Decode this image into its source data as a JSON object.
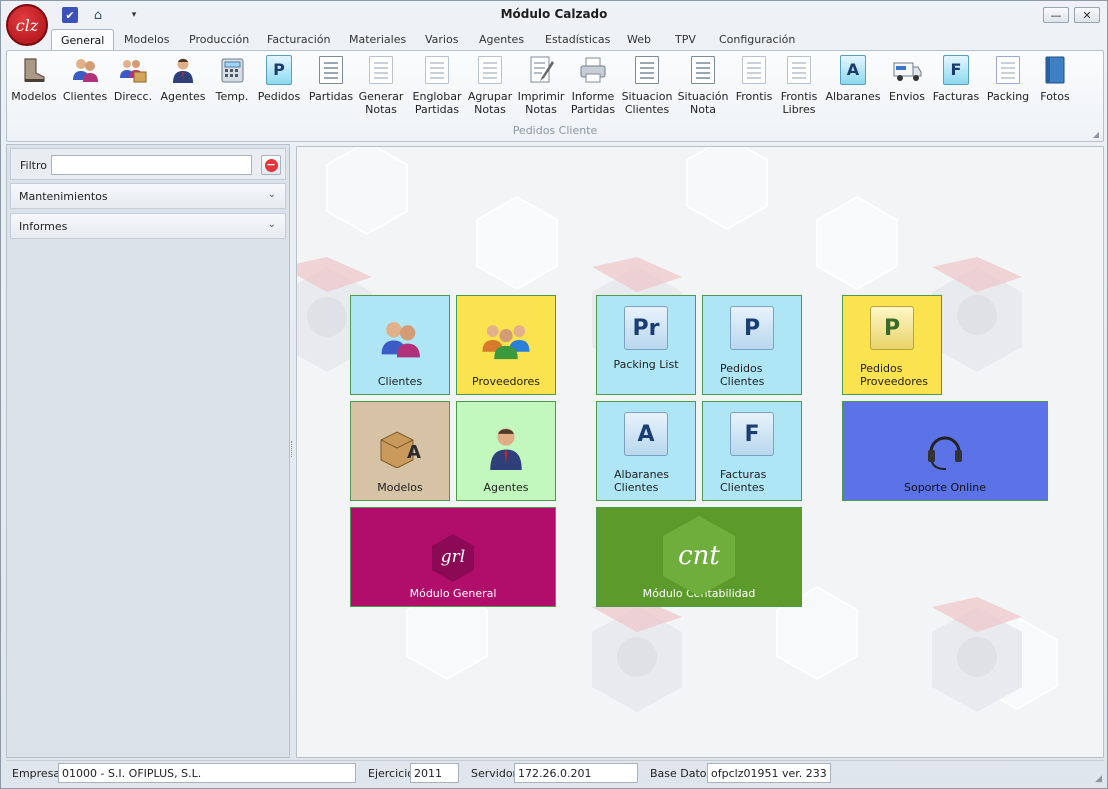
{
  "window": {
    "title": "Módulo Calzado",
    "logo_text": "clz",
    "minimize_glyph": "—",
    "close_glyph": "✕"
  },
  "quick_access": {
    "check_glyph": "✔",
    "home_glyph": "⌂",
    "dropdown_glyph": "▾"
  },
  "tabs": [
    {
      "label": "General",
      "active": true
    },
    {
      "label": "Modelos"
    },
    {
      "label": "Producción"
    },
    {
      "label": "Facturación"
    },
    {
      "label": "Materiales"
    },
    {
      "label": "Varios"
    },
    {
      "label": "Agentes"
    },
    {
      "label": "Estadísticas"
    },
    {
      "label": "Web"
    },
    {
      "label": "TPV"
    },
    {
      "label": "Configuración"
    }
  ],
  "ribbon": {
    "group_label": "Pedidos Cliente",
    "corner_glyph": "◢",
    "buttons": [
      {
        "label": "Modelos",
        "icon": "boot-icon"
      },
      {
        "label": "Clientes",
        "icon": "users-icon"
      },
      {
        "label": "Direcc.",
        "icon": "users-package-icon"
      },
      {
        "label": "Agentes",
        "icon": "agent-icon"
      },
      {
        "label": "Temp.",
        "icon": "calculator-icon"
      },
      {
        "label": "Pedidos",
        "icon": "order-doc-icon",
        "letter": "P"
      },
      {
        "label": "Partidas",
        "icon": "checklist-icon"
      },
      {
        "label": "Generar\nNotas",
        "icon": "note-doc-icon"
      },
      {
        "label": "Englobar\nPartidas",
        "icon": "note-doc-icon"
      },
      {
        "label": "Agrupar\nNotas",
        "icon": "note-doc-icon"
      },
      {
        "label": "Imprimir\nNotas",
        "icon": "edit-doc-icon"
      },
      {
        "label": "Informe\nPartidas",
        "icon": "printer-icon"
      },
      {
        "label": "Situacion\nClientes",
        "icon": "checklist-icon"
      },
      {
        "label": "Situación\nNota",
        "icon": "checklist-icon"
      },
      {
        "label": "Frontis",
        "icon": "note-doc-icon"
      },
      {
        "label": "Frontis\nLibres",
        "icon": "note-doc-icon"
      },
      {
        "label": "Albaranes",
        "icon": "delivery-note-icon",
        "letter": "A"
      },
      {
        "label": "Envios",
        "icon": "van-icon"
      },
      {
        "label": "Facturas",
        "icon": "invoice-icon",
        "letter": "F"
      },
      {
        "label": "Packing",
        "icon": "packing-icon"
      },
      {
        "label": "Fotos",
        "icon": "book-icon"
      }
    ]
  },
  "left_panel": {
    "filter_label": "Filtro",
    "filter_value": "",
    "filter_placeholder": "",
    "clear_glyph": "−",
    "sections": [
      {
        "label": "Mantenimientos",
        "chevron": "⌄"
      },
      {
        "label": "Informes",
        "chevron": "⌄"
      }
    ]
  },
  "tiles": {
    "clientes": {
      "label": "Clientes",
      "color": "#aee6f6"
    },
    "proveedores": {
      "label": "Proveedores",
      "color": "#fbe24f"
    },
    "packing_list": {
      "label": "Packing List",
      "color": "#aee6f6",
      "letter": "Pr"
    },
    "pedidos_clientes": {
      "label": "Pedidos\nClientes",
      "color": "#aee6f6",
      "letter": "P"
    },
    "pedidos_proveedores": {
      "label": "Pedidos\nProveedores",
      "color": "#fbe24f",
      "letter": "P"
    },
    "modelos": {
      "label": "Modelos",
      "color": "#d6c3a5",
      "letter": "A"
    },
    "agentes": {
      "label": "Agentes",
      "color": "#c2f7be"
    },
    "albaranes_clientes": {
      "label": "Albaranes\nClientes",
      "color": "#aee6f6",
      "letter": "A"
    },
    "facturas_clientes": {
      "label": "Facturas\nClientes",
      "color": "#aee6f6",
      "letter": "F"
    },
    "soporte_online": {
      "label": "Soporte Online",
      "color": "#5b73e6"
    },
    "modulo_general": {
      "label": "Módulo General",
      "color": "#b10d6a",
      "logo": "grl"
    },
    "modulo_contabilidad": {
      "label": "Módulo Contabilidad",
      "color": "#5d9a2c",
      "logo": "cnt"
    }
  },
  "status_bar": {
    "empresa_label": "Empresa",
    "empresa_value": "01000 - S.I. OFIPLUS, S.L.",
    "ejercicio_label": "Ejercicio",
    "ejercicio_value": "2011",
    "servidor_label": "Servidor",
    "servidor_value": "172.26.0.201",
    "base_datos_label": "Base Datos",
    "base_datos_value": "ofpclz01951 ver. 233",
    "grip_glyph": "◢"
  }
}
